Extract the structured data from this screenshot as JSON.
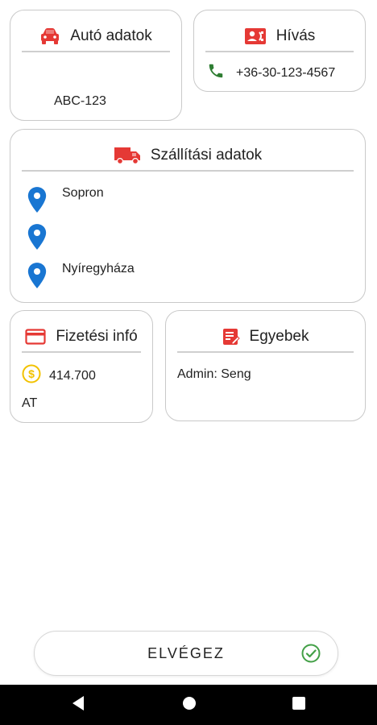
{
  "car": {
    "title": "Autó adatok",
    "plate": "ABC-123"
  },
  "call": {
    "title": "Hívás",
    "phone": "+36-30-123-4567"
  },
  "shipping": {
    "title": "Szállítási adatok",
    "stops": [
      "Sopron",
      "",
      "Nyíregyháza"
    ]
  },
  "payment": {
    "title": "Fizetési infó",
    "amount": "414.700",
    "method": "AT"
  },
  "other": {
    "title": "Egyebek",
    "note": "Admin: Seng"
  },
  "action": {
    "label": "ELVÉGEZ"
  },
  "colors": {
    "accent_red": "#e53935",
    "pin_blue": "#1976d2",
    "phone_green": "#2e7d32",
    "coin_yellow": "#f2c200",
    "check_green": "#43a047"
  },
  "icons": [
    "car-icon",
    "contact-call-icon",
    "phone-icon",
    "truck-icon",
    "location-pin-icon",
    "credit-card-icon",
    "dollar-coin-icon",
    "note-edit-icon",
    "check-circle-icon",
    "nav-back-icon",
    "nav-home-icon",
    "nav-recents-icon"
  ]
}
